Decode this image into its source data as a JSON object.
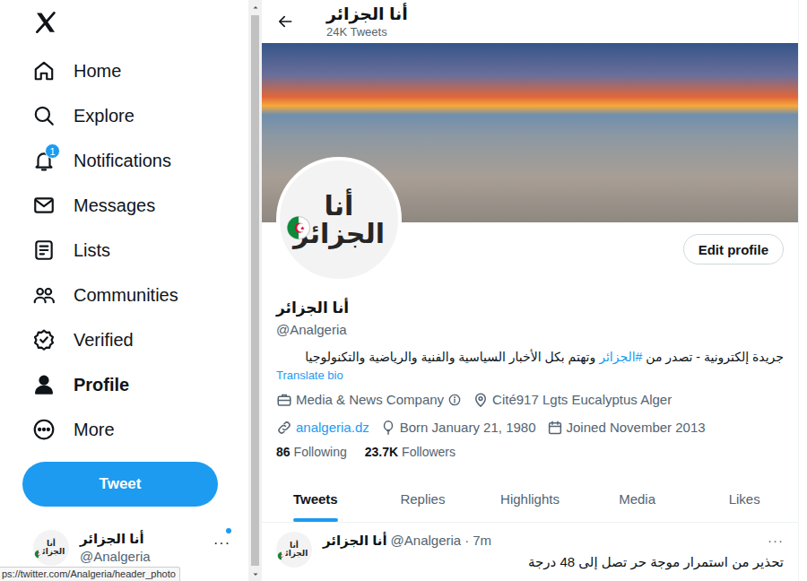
{
  "sidebar": {
    "items": [
      {
        "label": "Home",
        "selected": false
      },
      {
        "label": "Explore",
        "selected": false
      },
      {
        "label": "Notifications",
        "selected": false,
        "badge": "1"
      },
      {
        "label": "Messages",
        "selected": false
      },
      {
        "label": "Lists",
        "selected": false
      },
      {
        "label": "Communities",
        "selected": false
      },
      {
        "label": "Verified",
        "selected": false
      },
      {
        "label": "Profile",
        "selected": true
      },
      {
        "label": "More",
        "selected": false
      }
    ]
  },
  "tweet_button": "Tweet",
  "account": {
    "avatar_text": "أنا الجزائر",
    "name": "أنا الجزائر",
    "handle": "@Analgeria",
    "more": "···",
    "unread": true
  },
  "header": {
    "title": "أنا الجزائر",
    "subtitle": "24K Tweets"
  },
  "profile": {
    "avatar_text": "أنا الجزائر",
    "edit_button": "Edit profile",
    "name": "أنا الجزائر",
    "handle": "@Analgeria",
    "bio": [
      {
        "text": "جريدة إلكترونية - تصدر من ",
        "kind": "text"
      },
      {
        "text": "#الجزائر",
        "kind": "hashtag"
      },
      {
        "text": " وتهتم بكل الأخبار السياسية والفنية والرياضية والتكنولوجيا",
        "kind": "text"
      }
    ],
    "translate": "Translate bio",
    "meta": [
      {
        "text": "Media & News Company",
        "kind": "category"
      },
      {
        "text": "Cité917 Lgts Eucalyptus Alger",
        "kind": "location"
      },
      {
        "text": "analgeria.dz",
        "kind": "link"
      },
      {
        "text": "Born January 21, 1980",
        "kind": "birthday"
      },
      {
        "text": "Joined November 2013",
        "kind": "joined"
      }
    ],
    "stats": [
      {
        "count": "86",
        "label": "Following"
      },
      {
        "count": "23.7K",
        "label": "Followers"
      }
    ]
  },
  "tabs": [
    {
      "label": "Tweets",
      "selected": true
    },
    {
      "label": "Replies",
      "selected": false
    },
    {
      "label": "Highlights",
      "selected": false
    },
    {
      "label": "Media",
      "selected": false
    },
    {
      "label": "Likes",
      "selected": false
    }
  ],
  "tweets": [
    {
      "avatar_text": "أنا الجزائر",
      "name": "أنا الجزائر",
      "handle": "@Analgeria",
      "separator": "·",
      "time": "7m",
      "more": "···",
      "text": "تحذير من استمرار موجة حر تصل إلى 48 درجة"
    }
  ],
  "browser_status": "ps://twitter.com/Analgeria/header_photo"
}
